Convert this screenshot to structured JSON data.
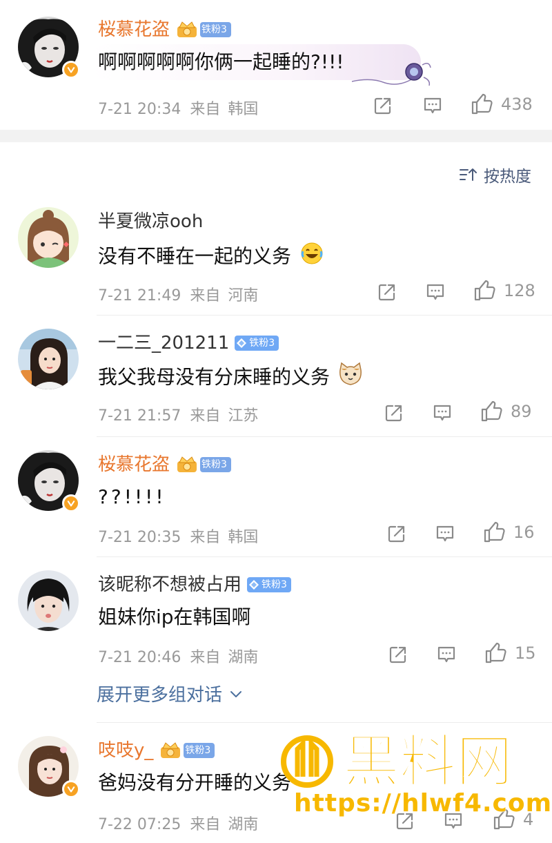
{
  "top_comment": {
    "username": "桜慕花盗",
    "fan_badge": "铁粉3",
    "content": "啊啊啊啊啊你俩一起睡的?!!!",
    "time": "7-21 20:34",
    "from": "来自",
    "location": "韩国",
    "likes": "438"
  },
  "sort_label": "按热度",
  "replies": [
    {
      "username": "半夏微凉ooh",
      "content": "没有不睡在一起的义务",
      "time": "7-21 21:49",
      "from": "来自",
      "location": "河南",
      "likes": "128"
    },
    {
      "username": "一二三_201211",
      "fan_badge": "铁粉3",
      "content": "我父我母没有分床睡的义务",
      "time": "7-21 21:57",
      "from": "来自",
      "location": "江苏",
      "likes": "89"
    },
    {
      "username": "桜慕花盗",
      "fan_badge": "铁粉3",
      "content": "??!!!!",
      "time": "7-21 20:35",
      "from": "来自",
      "location": "韩国",
      "likes": "16"
    },
    {
      "username": "该昵称不想被占用",
      "fan_badge": "铁粉3",
      "content": "姐妹你ip在韩国啊",
      "time": "7-21 20:46",
      "from": "来自",
      "location": "湖南",
      "likes": "15"
    },
    {
      "username": "吱吱y_",
      "fan_badge": "铁粉3",
      "content": "爸妈没有分开睡的义务",
      "time": "7-22 07:25",
      "from": "来自",
      "location": "湖南",
      "likes": "4"
    }
  ],
  "expand_label": "展开更多组对话",
  "watermark": {
    "brand": "黑料网",
    "url": "https://hlwf4.com"
  },
  "colors": {
    "username_orange": "#e8772e",
    "link_blue": "#4b6f9e",
    "meta_gray": "#999999",
    "vip_badge": "#f7a223",
    "fan_badge_blue": "#6fa8f5",
    "watermark": "#f7b800"
  },
  "icons": {
    "share": "share-icon",
    "comment": "comment-icon",
    "like": "like-icon",
    "sort": "sort-icon",
    "expand": "chevron-down-icon",
    "verified": "verified-v-icon"
  }
}
